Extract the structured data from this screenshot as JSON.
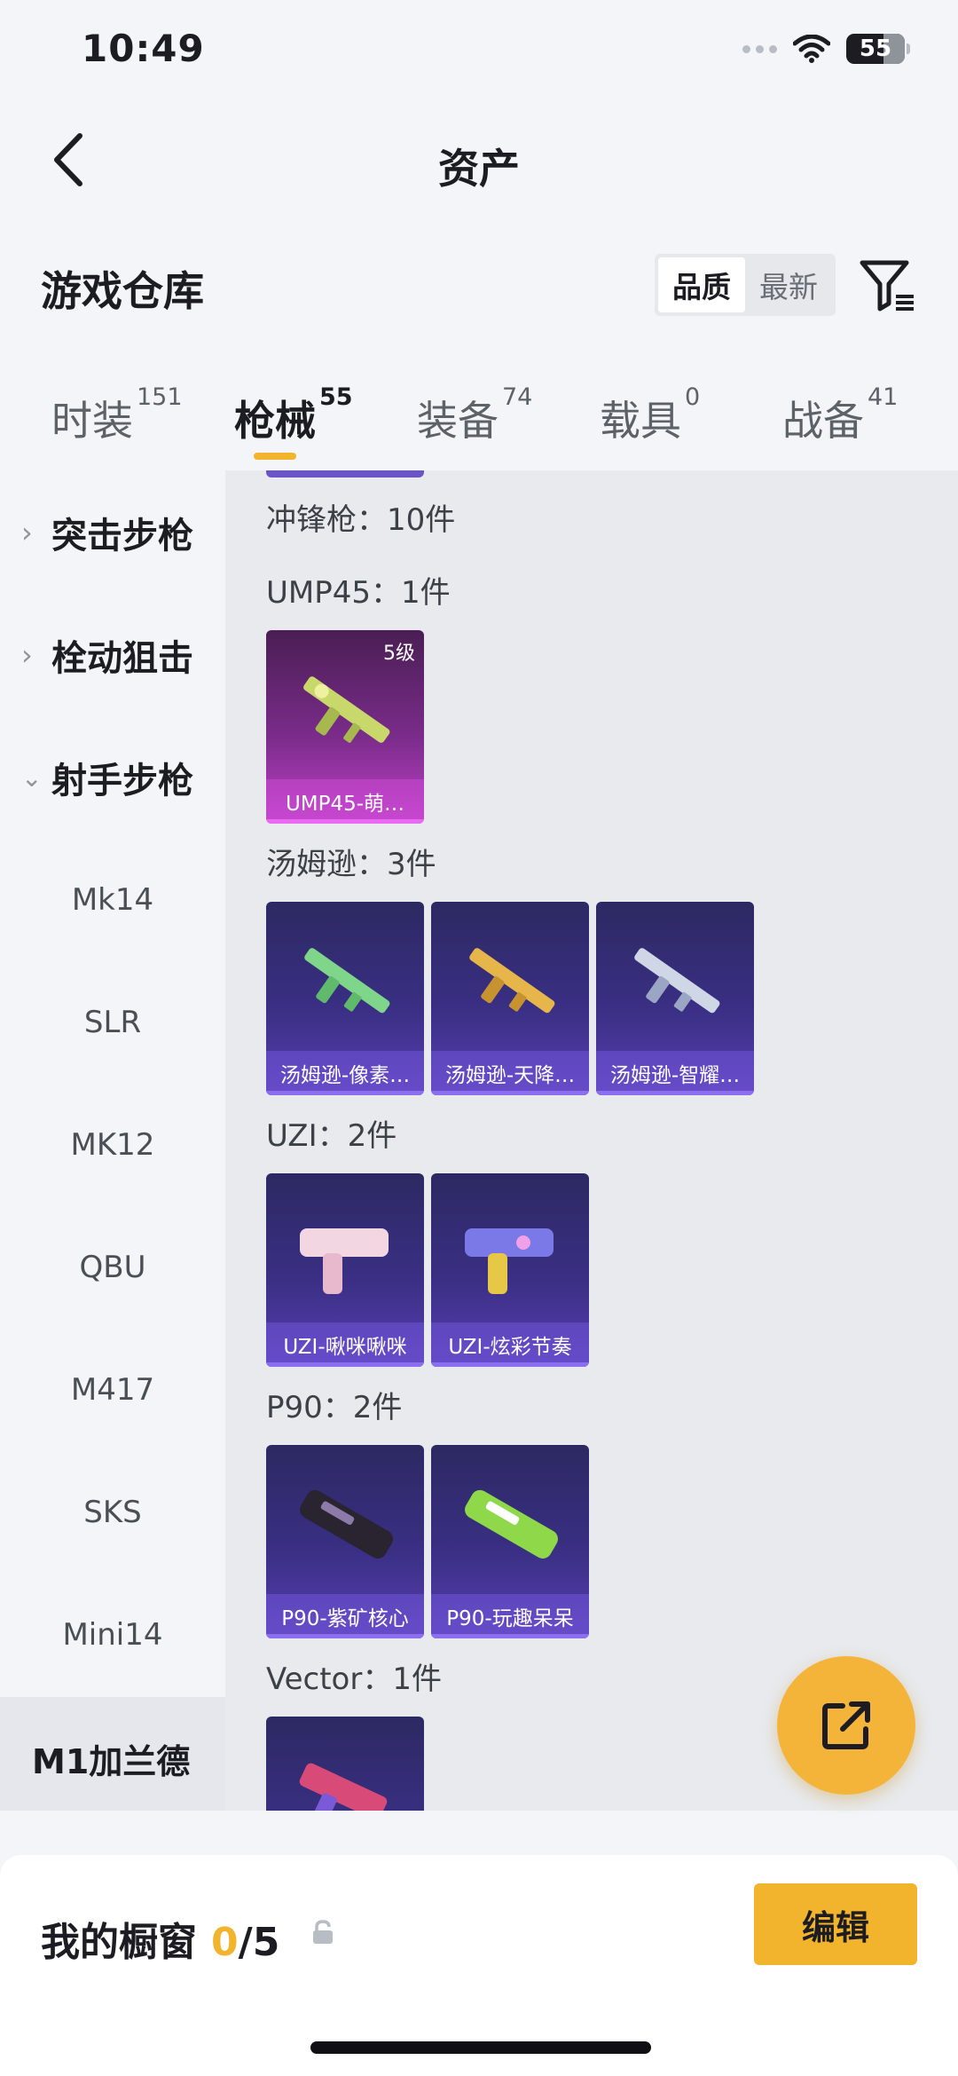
{
  "status_bar": {
    "time": "10:49",
    "battery": "55"
  },
  "nav": {
    "title": "资产"
  },
  "section": {
    "title": "游戏仓库"
  },
  "sort": {
    "options": [
      "品质",
      "最新"
    ],
    "selected": "品质"
  },
  "tabs": [
    {
      "label": "时装",
      "count": "151"
    },
    {
      "label": "枪械",
      "count": "55",
      "active": true
    },
    {
      "label": "装备",
      "count": "74"
    },
    {
      "label": "载具",
      "count": "0"
    },
    {
      "label": "战备",
      "count": "41"
    }
  ],
  "sidebar": {
    "categories": [
      {
        "label": "突击步枪",
        "expanded": false
      },
      {
        "label": "栓动狙击",
        "expanded": false
      },
      {
        "label": "射手步枪",
        "expanded": true
      }
    ],
    "subcategories": [
      "Mk14",
      "SLR",
      "MK12",
      "QBU",
      "M417",
      "SKS",
      "Mini14",
      "M1加兰德"
    ],
    "selected": "M1加兰德"
  },
  "inventory": {
    "category_summary": "冲锋枪：10件",
    "groups": [
      {
        "title": "UMP45：1件",
        "items": [
          {
            "name": "UMP45-萌…",
            "level": "5级",
            "rarity": "purple"
          }
        ]
      },
      {
        "title": "汤姆逊：3件",
        "items": [
          {
            "name": "汤姆逊-像素…"
          },
          {
            "name": "汤姆逊-天降…"
          },
          {
            "name": "汤姆逊-智耀…"
          }
        ]
      },
      {
        "title": "UZI：2件",
        "items": [
          {
            "name": "UZI-啾咪啾咪"
          },
          {
            "name": "UZI-炫彩节奏"
          }
        ]
      },
      {
        "title": "P90：2件",
        "items": [
          {
            "name": "P90-紫矿核心"
          },
          {
            "name": "P90-玩趣呆呆"
          }
        ]
      },
      {
        "title": "Vector：1件",
        "items": [
          {
            "name": ""
          }
        ]
      }
    ]
  },
  "showcase": {
    "title": "我的橱窗",
    "count": "0",
    "total": "/5",
    "edit_label": "编辑"
  },
  "colors": {
    "accent": "#f2b42c",
    "card_blue": "#3a2f84",
    "card_purple": "#7a2c8a"
  },
  "icons": [
    "back-icon",
    "filter-icon",
    "lock-icon",
    "share-icon",
    "wifi-icon",
    "battery-icon"
  ]
}
